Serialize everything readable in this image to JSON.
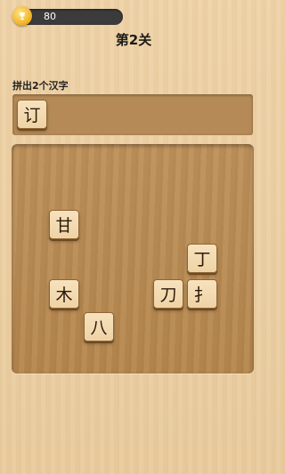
{
  "header": {
    "coins": "80",
    "level_title": "第2关"
  },
  "puzzle": {
    "instruction": "拼出2个汉字",
    "answer_slots": [
      "订"
    ]
  },
  "board": {
    "tiles": [
      "甘",
      "丁",
      "木",
      "刀",
      "扌",
      "八"
    ]
  },
  "colors": {
    "coin_pill": "#3b3b3b",
    "coin": "#f3b62b",
    "tile_face": "#f3dab1",
    "tile_border": "#8f6534",
    "board": "#b98c55",
    "answer_panel": "#b58a56"
  }
}
